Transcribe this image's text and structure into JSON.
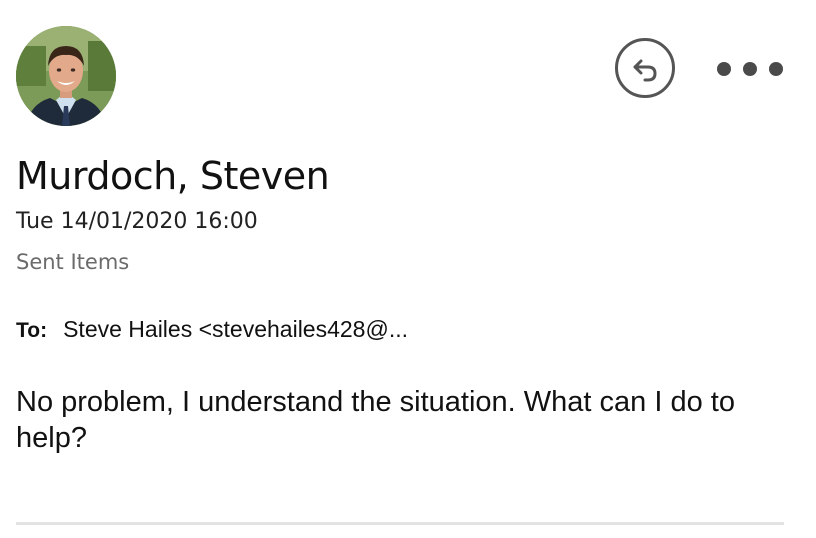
{
  "message": {
    "sender_name": "Murdoch, Steven",
    "date": "Tue 14/01/2020 16:00",
    "folder": "Sent Items",
    "to_label": "To:",
    "to_value": "Steve Hailes <stevehailes428@...",
    "body": "No problem, I understand the situation. What can I do to help?"
  },
  "actions": {
    "reply_icon": "reply-icon",
    "more_icon": "more-options-icon"
  },
  "colors": {
    "text": "#111111",
    "muted": "#6b6b6b",
    "icon": "#555555",
    "divider": "#e3e3e3"
  }
}
